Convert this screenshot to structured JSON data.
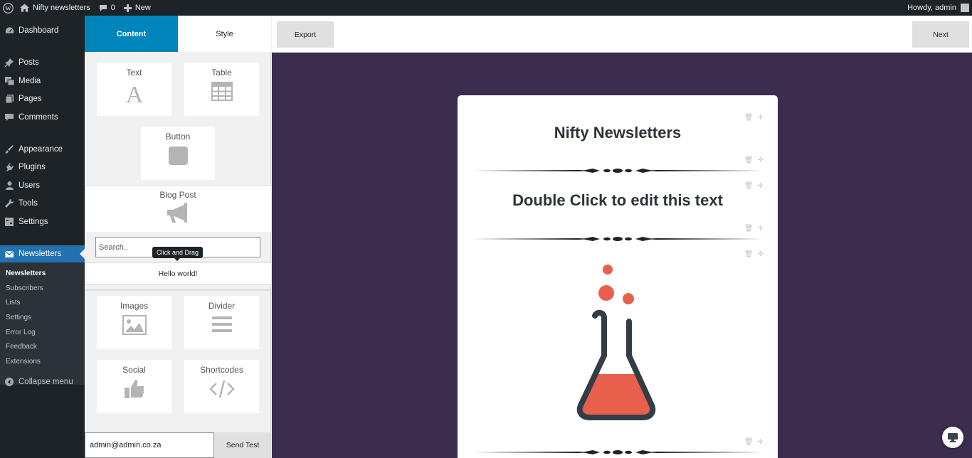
{
  "adminbar": {
    "site_name": "Nifty newsletters",
    "comments_count": "0",
    "new_label": "New",
    "howdy": "Howdy, admin"
  },
  "sidebar": {
    "items": [
      {
        "label": "Dashboard",
        "icon": "dashboard-icon"
      },
      {
        "label": "Posts",
        "icon": "pin-icon"
      },
      {
        "label": "Media",
        "icon": "media-icon"
      },
      {
        "label": "Pages",
        "icon": "pages-icon"
      },
      {
        "label": "Comments",
        "icon": "comment-icon"
      },
      {
        "label": "Appearance",
        "icon": "brush-icon"
      },
      {
        "label": "Plugins",
        "icon": "plug-icon"
      },
      {
        "label": "Users",
        "icon": "user-icon"
      },
      {
        "label": "Tools",
        "icon": "wrench-icon"
      },
      {
        "label": "Settings",
        "icon": "settings-icon"
      },
      {
        "label": "Newsletters",
        "icon": "envelope-icon"
      }
    ],
    "submenu": [
      "Newsletters",
      "Subscribers",
      "Lists",
      "Settings",
      "Error Log",
      "Feedback",
      "Extensions"
    ],
    "collapse_label": "Collapse menu"
  },
  "builder": {
    "tabs": {
      "content": "Content",
      "style": "Style"
    },
    "blocks": {
      "text": "Text",
      "table": "Table",
      "button": "Button",
      "blog_post": "Blog Post",
      "images": "Images",
      "divider": "Divider",
      "social": "Social",
      "shortcodes": "Shortcodes"
    },
    "search_placeholder": "Search..",
    "tooltip": "Click and Drag",
    "post_item": "Hello world!",
    "test_email": "admin@admin.co.za",
    "send_test_label": "Send Test"
  },
  "toolbar": {
    "export_label": "Export",
    "next_label": "Next"
  },
  "newsletter": {
    "title": "Nifty Newsletters",
    "text": "Double Click to edit this text"
  },
  "colors": {
    "accent": "#0085ba",
    "admin_active": "#2271b1",
    "canvas_bg": "#3a2d4e",
    "flask_liquid": "#e8604c",
    "flask_outline": "#333d47"
  }
}
